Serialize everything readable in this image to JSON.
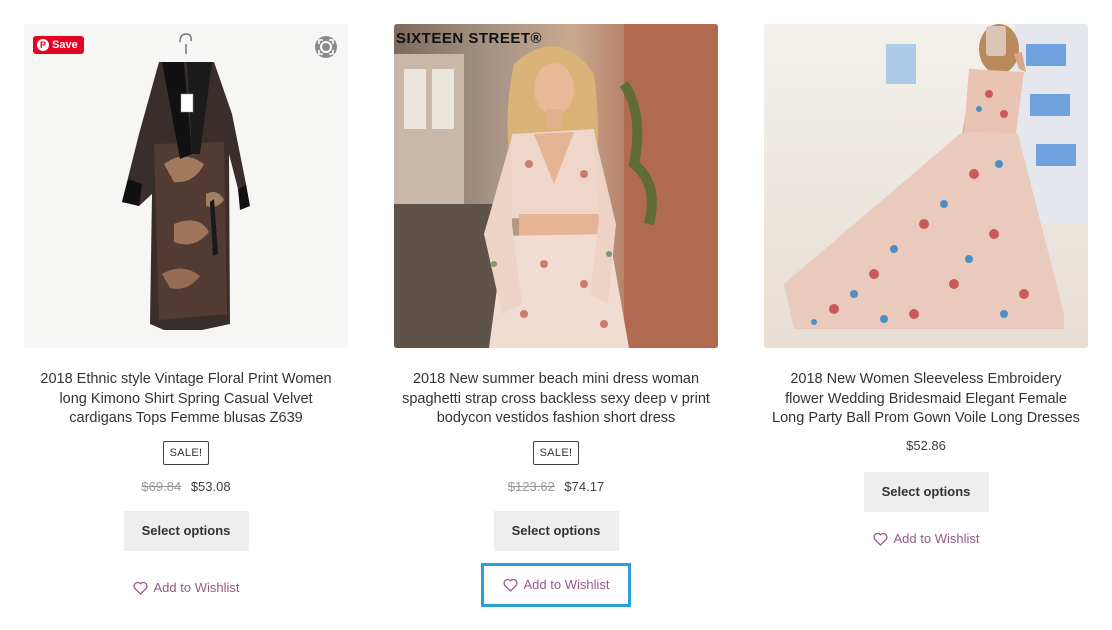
{
  "products": [
    {
      "title": "2018 Ethnic style Vintage Floral Print Women long Kimono Shirt Spring Casual Velvet cardigans Tops Femme blusas Z639",
      "badge": "SALE!",
      "old_price": "$69.84",
      "price": "$53.08",
      "button": "Select options",
      "wishlist": "Add to Wishlist",
      "image_overlay": {
        "pinterest_save": "Save",
        "icon": "lens-icon"
      }
    },
    {
      "title": "2018 New summer beach mini dress woman spaghetti strap cross backless sexy deep v print bodycon vestidos fashion short dress",
      "badge": "SALE!",
      "old_price": "$123.62",
      "price": "$74.17",
      "button": "Select options",
      "wishlist": "Add to Wishlist",
      "image_overlay": {
        "watermark": "SIXTEEN STREET®"
      }
    },
    {
      "title": "2018 New Women Sleeveless Embroidery flower Wedding Bridesmaid Elegant Female Long Party Ball Prom Gown Voile Long Dresses",
      "price": "$52.86",
      "button": "Select options",
      "wishlist": "Add to Wishlist"
    }
  ],
  "colors": {
    "wishlist_link": "#96588a",
    "focus_outline": "#2a9ed9",
    "pinterest": "#e60023",
    "button_bg": "#eeeeee"
  }
}
